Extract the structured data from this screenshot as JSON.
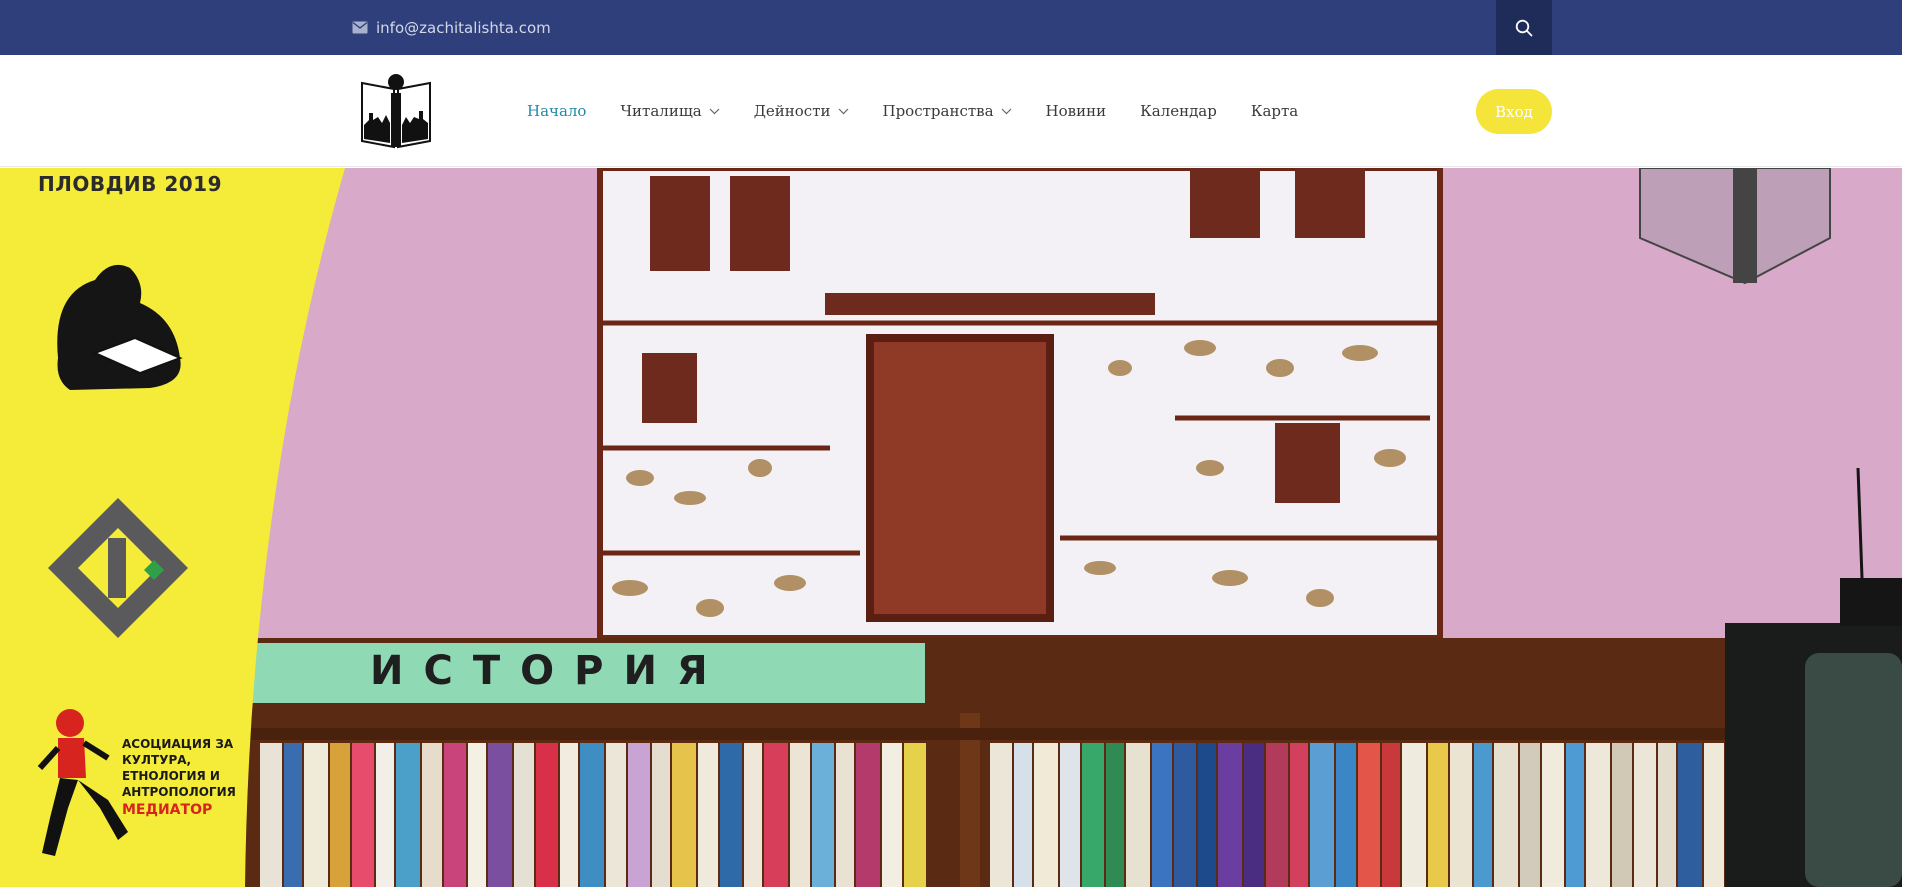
{
  "topbar": {
    "email": "info@zachitalishta.com",
    "email_icon": "mail-icon",
    "search_icon": "search-icon"
  },
  "header": {
    "logo_icon": "chitalishte-logo-icon",
    "nav": [
      {
        "label": "Начало",
        "active": true,
        "has_dropdown": false
      },
      {
        "label": "Читалища",
        "active": false,
        "has_dropdown": true
      },
      {
        "label": "Дейности",
        "active": false,
        "has_dropdown": true
      },
      {
        "label": "Пространства",
        "active": false,
        "has_dropdown": true
      },
      {
        "label": "Новини",
        "active": false,
        "has_dropdown": false
      },
      {
        "label": "Календар",
        "active": false,
        "has_dropdown": false
      },
      {
        "label": "Карта",
        "active": false,
        "has_dropdown": false
      }
    ],
    "login_label": "Вход"
  },
  "hero": {
    "sidebar_heading": "ПЛОВДИВ 2019",
    "shelf_sign": "ИСТОРИЯ",
    "association_lines": [
      "АСОЦИАЦИЯ ЗА",
      "КУЛТУРА,",
      "ЕТНОЛОГИЯ И",
      "АНТРОПОЛОГИЯ"
    ],
    "association_brand": "МЕДИАТОР"
  },
  "colors": {
    "topbar": "#2e3f7c",
    "search_bg": "#1f2c59",
    "nav_active": "#1f8aa8",
    "login_bg": "#f5e43a",
    "sidebar_yellow": "#f5ec3a",
    "wall_pink": "#d9a9c9"
  }
}
